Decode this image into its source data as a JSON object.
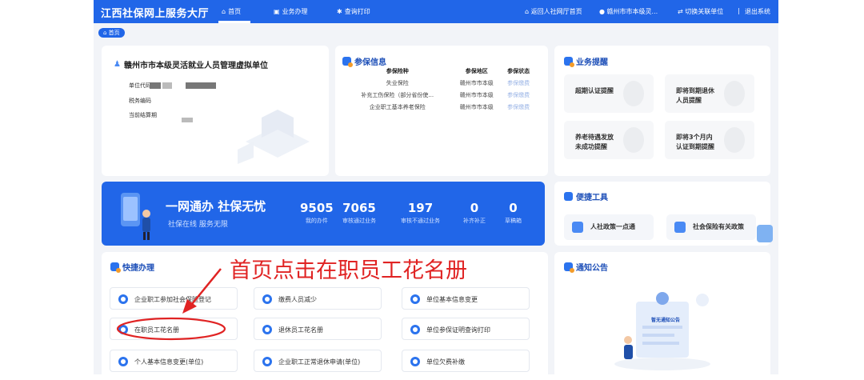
{
  "header": {
    "site_title": "江西社保网上服务大厅",
    "nav": [
      {
        "label": "首页",
        "icon": "home-icon"
      },
      {
        "label": "业务办理",
        "icon": "briefcase-icon"
      },
      {
        "label": "查询打印",
        "icon": "print-icon"
      }
    ],
    "right": {
      "back_link": "返回人社网厅首页",
      "user": "赣州市市本级灵...",
      "switch_unit": "切换关联单位",
      "separator": "|",
      "logout": "退出系统"
    }
  },
  "breadcrumb": "首页",
  "unit_card": {
    "name": "赣州市市本级灵活就业人员管理虚拟单位",
    "labels": [
      "单位代码",
      "税务编码",
      "当前结算期"
    ]
  },
  "insurance_card": {
    "title": "参保信息",
    "columns": [
      "参保险种",
      "参保地区",
      "参保状态"
    ],
    "rows": [
      [
        "失业保险",
        "赣州市市本级",
        "参保缴费"
      ],
      [
        "补充工伤保险（部分省份使...",
        "赣州市市本级",
        "参保缴费"
      ],
      [
        "企业职工基本养老保险",
        "赣州市市本级",
        "参保缴费"
      ]
    ]
  },
  "reminder_card": {
    "title": "业务提醒",
    "items": [
      "超期认证提醒",
      "即将到期退休\n人员提醒",
      "养老待遇发放\n未成功提醒",
      "即将3个月内\n认证到期提醒"
    ]
  },
  "banner": {
    "slogan": "一网通办 社保无忧",
    "subtitle": "社保在线 服务无限",
    "stats": [
      {
        "value": "9505",
        "label": "我的办件"
      },
      {
        "value": "7065",
        "label": "审核通过业务"
      },
      {
        "value": "197",
        "label": "审核不通过业务"
      },
      {
        "value": "0",
        "label": "补齐补正"
      },
      {
        "value": "0",
        "label": "草稿箱"
      }
    ]
  },
  "tools_card": {
    "title": "便捷工具",
    "items": [
      "人社政策一点通",
      "社会保险有关政策"
    ]
  },
  "quick_card": {
    "title": "快捷办理",
    "items": [
      "企业职工参加社会保险登记",
      "缴费人员减少",
      "单位基本信息变更",
      "在职员工花名册",
      "退休员工花名册",
      "单位参保证明查询打印",
      "个人基本信息变更(单位)",
      "企业职工正常退休申请(单位)",
      "单位欠费补缴"
    ]
  },
  "notice_card": {
    "title": "通知公告",
    "empty_text": "暂无通知公告"
  },
  "annotation": {
    "text": "首页点击在职员工花名册",
    "color": "#e02323"
  },
  "colors": {
    "primary": "#2166e8",
    "annotation": "#e02323"
  }
}
